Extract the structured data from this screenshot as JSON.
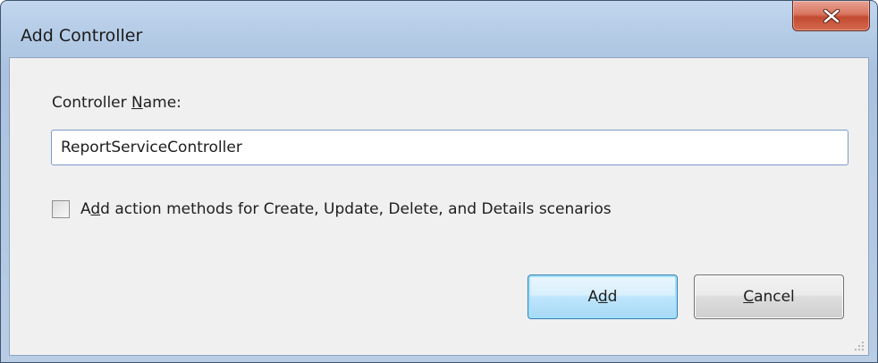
{
  "window": {
    "title": "Add Controller",
    "close_icon": "close-x-icon"
  },
  "form": {
    "controller_name_label_pre": "Controller ",
    "controller_name_label_accel": "N",
    "controller_name_label_post": "ame:",
    "controller_name_value": "ReportServiceController",
    "action_methods_checked": false,
    "action_methods_label_pre": "A",
    "action_methods_label_accel": "d",
    "action_methods_label_post": "d action methods for Create, Update, Delete, and Details scenarios"
  },
  "buttons": {
    "add_pre": "A",
    "add_accel": "d",
    "add_post": "d",
    "cancel_accel": "C",
    "cancel_post": "ancel"
  },
  "colors": {
    "close_button": "#c75a40",
    "default_button_border": "#3c7fb1",
    "title_bar": "#b9cde5"
  }
}
